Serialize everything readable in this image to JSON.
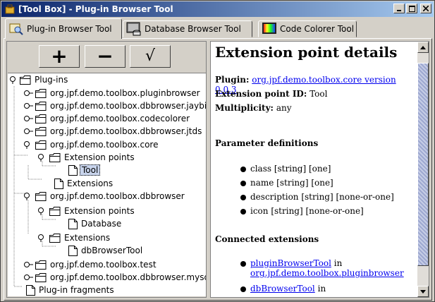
{
  "window": {
    "title": "[Tool Box] - Plug-in Browser Tool",
    "minimize": "_",
    "maximize": "□",
    "close": "×"
  },
  "tabs": [
    {
      "label": "Plug-in Browser Tool",
      "active": true,
      "icon": "plugin-browser-icon"
    },
    {
      "label": "Database Browser Tool",
      "active": false,
      "icon": "database-icon"
    },
    {
      "label": "Code Colorer Tool",
      "active": false,
      "icon": "code-colorer-icon"
    }
  ],
  "toolbar": {
    "add": "+",
    "remove": "−",
    "check": "√"
  },
  "tree": [
    {
      "label": "Plug-ins",
      "type": "folder",
      "open": true
    },
    {
      "label": "org.jpf.demo.toolbox.pluginbrowser",
      "type": "folder",
      "open": false
    },
    {
      "label": "org.jpf.demo.toolbox.dbbrowser.jaybird",
      "type": "folder",
      "open": false
    },
    {
      "label": "org.jpf.demo.toolbox.codecolorer",
      "type": "folder",
      "open": false
    },
    {
      "label": "org.jpf.demo.toolbox.dbbrowser.jtds",
      "type": "folder",
      "open": false
    },
    {
      "label": "org.jpf.demo.toolbox.core",
      "type": "folder",
      "open": true
    },
    {
      "label": "Extension points",
      "type": "folder",
      "open": true
    },
    {
      "label": "Tool",
      "type": "doc",
      "selected": true
    },
    {
      "label": "Extensions",
      "type": "doc"
    },
    {
      "label": "org.jpf.demo.toolbox.dbbrowser",
      "type": "folder",
      "open": true
    },
    {
      "label": "Extension points",
      "type": "folder",
      "open": true
    },
    {
      "label": "Database",
      "type": "doc"
    },
    {
      "label": "Extensions",
      "type": "folder",
      "open": true
    },
    {
      "label": "dbBrowserTool",
      "type": "doc"
    },
    {
      "label": "org.jpf.demo.toolbox.test",
      "type": "folder",
      "open": false
    },
    {
      "label": "org.jpf.demo.toolbox.dbbrowser.mysql",
      "type": "folder",
      "open": false
    },
    {
      "label": "Plug-in fragments",
      "type": "doc"
    }
  ],
  "details": {
    "heading": "Extension point details",
    "plugin_label": "Plugin:",
    "plugin_value": "org.jpf.demo.toolbox.core version 0.0.3",
    "epid_label": "Extension point ID:",
    "epid_value": "Tool",
    "mult_label": "Multiplicity:",
    "mult_value": "any",
    "params_heading": "Parameter definitions",
    "params": [
      "class [string] [one]",
      "name [string] [one]",
      "description [string] [none-or-one]",
      "icon [string] [none-or-one]"
    ],
    "connected_heading": "Connected extensions",
    "ext1_link": "pluginBrowserTool",
    "ext1_in": "in",
    "ext1_plugin": "org.jpf.demo.toolbox.pluginbrowser",
    "ext2_link": "dbBrowserTool",
    "ext2_in": "in"
  }
}
